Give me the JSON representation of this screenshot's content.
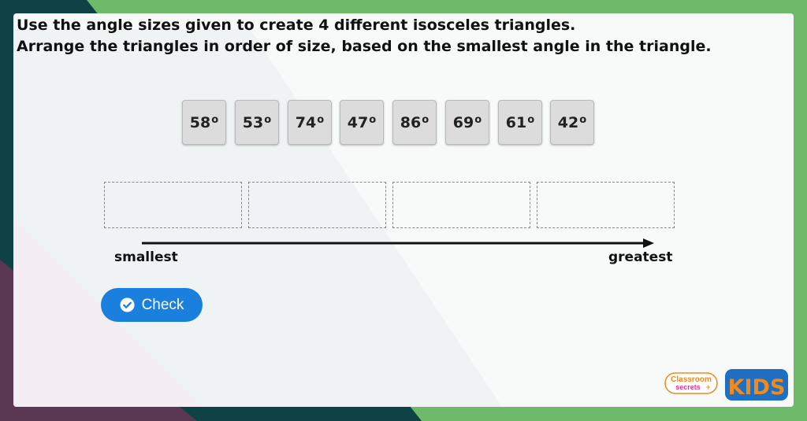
{
  "instructions": {
    "line1": "Use the angle sizes given to create 4 different isosceles triangles.",
    "line2": "Arrange the triangles in order of size, based on the smallest angle in the triangle."
  },
  "angle_tiles": [
    {
      "value": "58",
      "unit": "o"
    },
    {
      "value": "53",
      "unit": "o"
    },
    {
      "value": "74",
      "unit": "o"
    },
    {
      "value": "47",
      "unit": "o"
    },
    {
      "value": "86",
      "unit": "o"
    },
    {
      "value": "69",
      "unit": "o"
    },
    {
      "value": "61",
      "unit": "o"
    },
    {
      "value": "42",
      "unit": "o"
    }
  ],
  "drop_slots_count": 4,
  "axis": {
    "start_label": "smallest",
    "end_label": "greatest"
  },
  "check_button": {
    "label": "Check",
    "icon": "check-circle-icon"
  },
  "logo": {
    "brand_line1": "Classroom",
    "brand_line2": "secrets",
    "kids": "KIDS"
  },
  "colors": {
    "frame_green": "#6dbb6a",
    "frame_teal": "#0f4245",
    "frame_plum": "#5a3752",
    "button_blue": "#1b7fde",
    "tile_grey": "#dcdcdc",
    "logo_blue": "#1f6fc3",
    "logo_orange": "#f08a1c"
  }
}
